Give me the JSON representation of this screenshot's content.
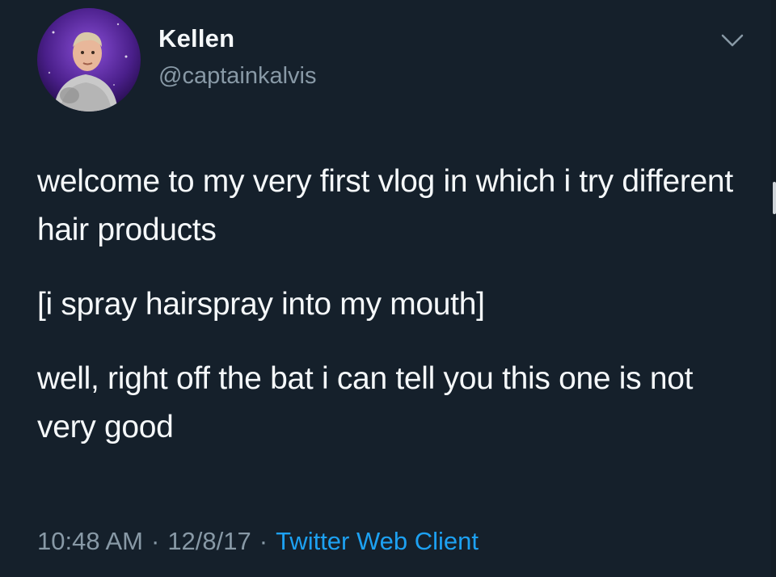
{
  "author": {
    "display_name": "Kellen",
    "handle": "@captainkalvis"
  },
  "tweet": {
    "paragraphs": [
      "welcome to my very first vlog in which i try different hair products",
      "[i spray hairspray into my mouth]",
      "well, right off the bat i can tell you this one is not very good"
    ]
  },
  "meta": {
    "time": "10:48 AM",
    "separator": "·",
    "date": "12/8/17",
    "client": "Twitter Web Client"
  },
  "icons": {
    "menu": "chevron-down-icon",
    "avatar": "avatar"
  },
  "colors": {
    "background": "#15202b",
    "primary_text": "#f5f8fa",
    "secondary_text": "#8899a6",
    "link": "#1da1f2"
  }
}
